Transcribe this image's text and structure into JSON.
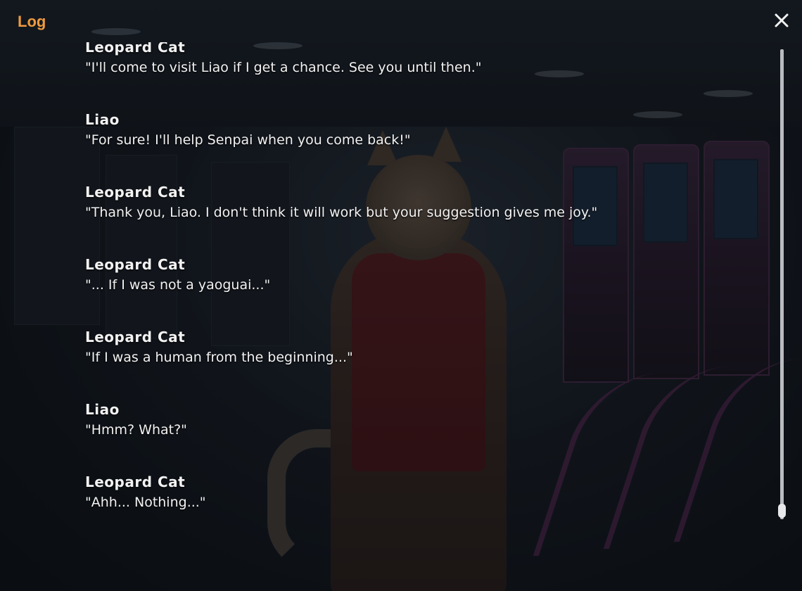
{
  "log": {
    "title": "Log",
    "close_icon": "close-icon"
  },
  "entries": [
    {
      "speaker": "Leopard Cat",
      "text": "\"I'll come to visit Liao if I get a chance. See you until then.\""
    },
    {
      "speaker": "Liao",
      "text": "\"For sure! I'll help Senpai when you come back!\""
    },
    {
      "speaker": "Leopard Cat",
      "text": "\"Thank you, Liao. I don't think it will work but your suggestion gives me joy.\""
    },
    {
      "speaker": "Leopard Cat",
      "text": "\"... If I was not a yaoguai...\""
    },
    {
      "speaker": "Leopard Cat",
      "text": "\"If I was a human from the beginning...\""
    },
    {
      "speaker": "Liao",
      "text": "\"Hmm? What?\""
    },
    {
      "speaker": "Leopard Cat",
      "text": "\"Ahh... Nothing...\""
    }
  ],
  "scroll": {
    "position": 1.0
  },
  "colors": {
    "title": "#f09a3e",
    "text": "#f2f2f2"
  }
}
